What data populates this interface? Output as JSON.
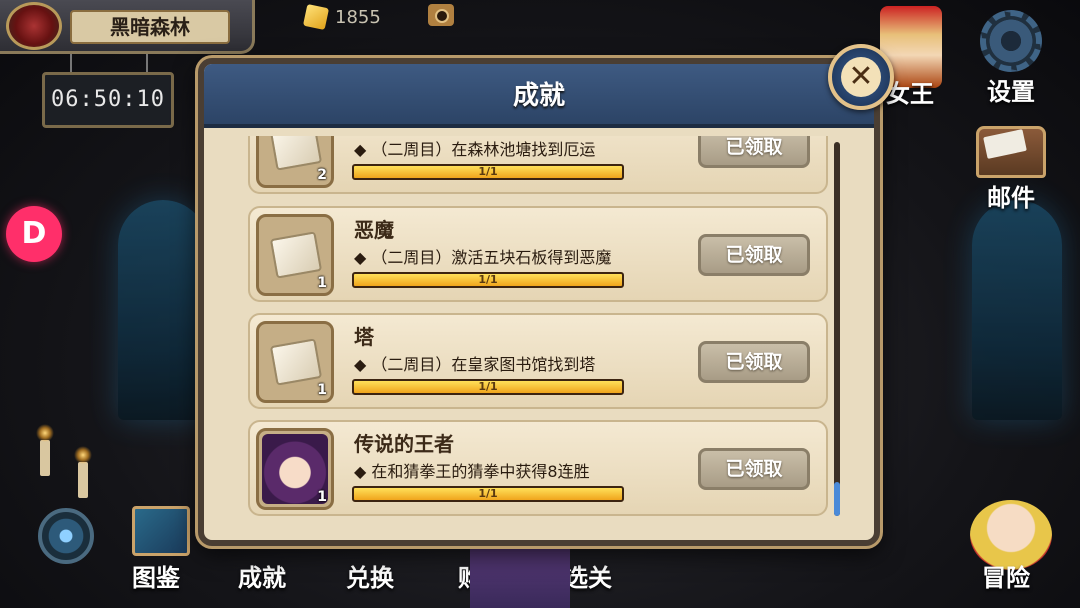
{
  "location": {
    "name": "黑暗森林",
    "timer": "06:50:10"
  },
  "currency": {
    "gems": "1855"
  },
  "right_menu": {
    "queen_label": "女王",
    "settings_label": "设置",
    "mail_label": "邮件"
  },
  "side_badge": {
    "label": "D"
  },
  "bottom_nav": {
    "items": [
      {
        "label": "图鉴"
      },
      {
        "label": "成就"
      },
      {
        "label": "兑换"
      },
      {
        "label": "购买"
      },
      {
        "label": "选关"
      },
      {
        "label": "冒险"
      }
    ]
  },
  "modal": {
    "title": "成就",
    "close_label": "✕",
    "achievements": [
      {
        "title": "",
        "desc": "◆ （二周目）在森林池塘找到厄运",
        "qty": "2",
        "progress_text": "1/1",
        "progress": 1.0,
        "button": "已领取",
        "reward": "ticket-icon"
      },
      {
        "title": "恶魔",
        "desc": "◆ （二周目）激活五块石板得到恶魔",
        "qty": "1",
        "progress_text": "1/1",
        "progress": 1.0,
        "button": "已领取",
        "reward": "ticket-icon"
      },
      {
        "title": "塔",
        "desc": "◆ （二周目）在皇家图书馆找到塔",
        "qty": "1",
        "progress_text": "1/1",
        "progress": 1.0,
        "button": "已领取",
        "reward": "ticket-icon"
      },
      {
        "title": "传说的王者",
        "desc": "◆ 在和猜拳王的猜拳中获得8连胜",
        "qty": "1",
        "progress_text": "1/1",
        "progress": 1.0,
        "button": "已领取",
        "reward": "portrait"
      }
    ]
  }
}
